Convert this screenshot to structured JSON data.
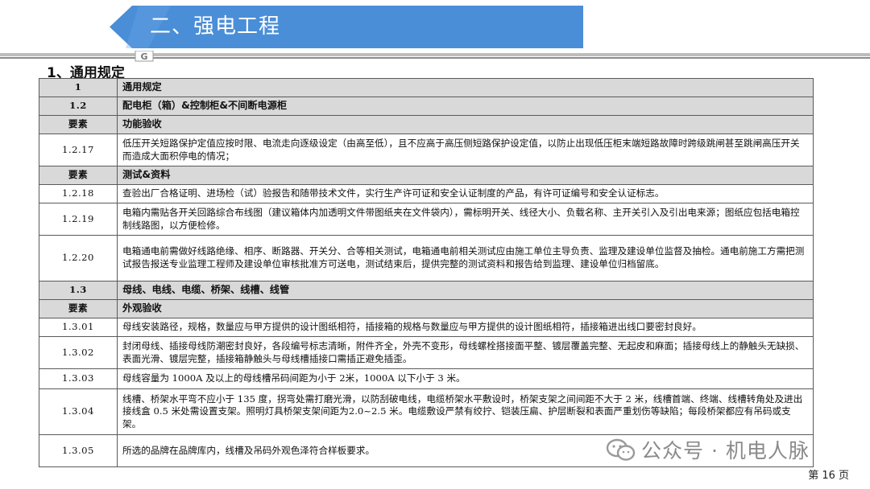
{
  "header": {
    "title": "二、强电工程",
    "logo_letter": "G"
  },
  "section_title": "1、通用规定",
  "rows": [
    {
      "code": "1",
      "text": "通用规定",
      "header": true
    },
    {
      "code": "1.2",
      "text": "配电柜（箱）&控制柜&不间断电源柜",
      "header": true
    },
    {
      "code": "要素",
      "text": "功能验收",
      "header": true
    },
    {
      "code": "1.2.17",
      "text": "低压开关短路保护定值应按时限、电流走向逐级设定（由高至低），且不应高于高压侧短路保护设定值，以防止出现低压柜末端短路故障时跨级跳闸甚至跳闸高压开关而造成大面积停电的情况；",
      "header": false
    },
    {
      "code": "要素",
      "text": "测试&资料",
      "header": true
    },
    {
      "code": "1.2.18",
      "text": "查验出厂合格证明、进场检（试）验报告和随带技术文件，实行生产许可证和安全认证制度的产品，有许可证编号和安全认证标志。",
      "header": false
    },
    {
      "code": "1.2.19",
      "text": "电箱内需贴各开关回路综合布线图（建议箱体内加透明文件带图纸夹在文件袋内），需标明开关、线径大小、负载名称、主开关引入及引出电来源；图纸应包括电箱控制线路图，以方便检修。",
      "header": false
    },
    {
      "code": "1.2.20",
      "text": "电箱通电前需做好线路绝缘、相序、断路器、开关分、合等相关测试，电箱通电前相关测试应由施工单位主导负责、监理及建设单位监督及抽检。通电前施工方需把测试报告报送专业监理工程师及建设单位审核批准方可送电，测试结束后，提供完整的测试资料和报告给到监理、建设单位归档留底。",
      "header": false
    },
    {
      "code": "1.3",
      "text": "母线、电线、电缆、桥架、线槽、线管",
      "header": true
    },
    {
      "code": "要素",
      "text": "外观验收",
      "header": true
    },
    {
      "code": "1.3.01",
      "text": "母线安装路径，规格，数量应与甲方提供的设计图纸相符，插接箱的规格与数量应与甲方提供的设计图纸相符，插接箱进出线口要密封良好。",
      "header": false
    },
    {
      "code": "1.3.02",
      "text": "封闭母线、插接母线防潮密封良好，各段编号标志清晰，附件齐全，外壳不变形，母线螺栓搭接面平整、镀层覆盖完整、无起皮和麻面；插接母线上的静触头无缺损、表面光滑、镀层完整，插接箱静触头与母线槽插接口需插正避免插歪。",
      "header": false
    },
    {
      "code": "1.3.03",
      "text": "母线容量为 1000A 及以上的母线槽吊码间距为小于 2米，1000A 以下小于 3 米。",
      "header": false
    },
    {
      "code": "1.3.04",
      "text": "线槽、桥架水平弯不应小于 135 度，拐弯处需打磨光滑，以防刮破电线，电缆桥架水平敷设时，桥架支架之间间距不大于 2 米，线槽首端、终端、线槽转角处及进出接线盒 0.5 米处需设置支架。照明灯具桥架支架间距为2.0~2.5 米。电缆敷设严禁有绞拧、铠装压扁、护层断裂和表面严重划伤等缺陷；每段桥架都应有吊码或支架。",
      "header": false
    },
    {
      "code": "1.3.05",
      "text": "所选的品牌在品牌库内，线槽及吊码外观色泽符合样板要求。",
      "header": false
    }
  ],
  "watermark": "公众号 · 机电人脉",
  "page_label": "第 16 页",
  "colors": {
    "banner": "#4a8ed8",
    "header_row": "#d9d9d9",
    "bar": "#bdbdbd"
  }
}
